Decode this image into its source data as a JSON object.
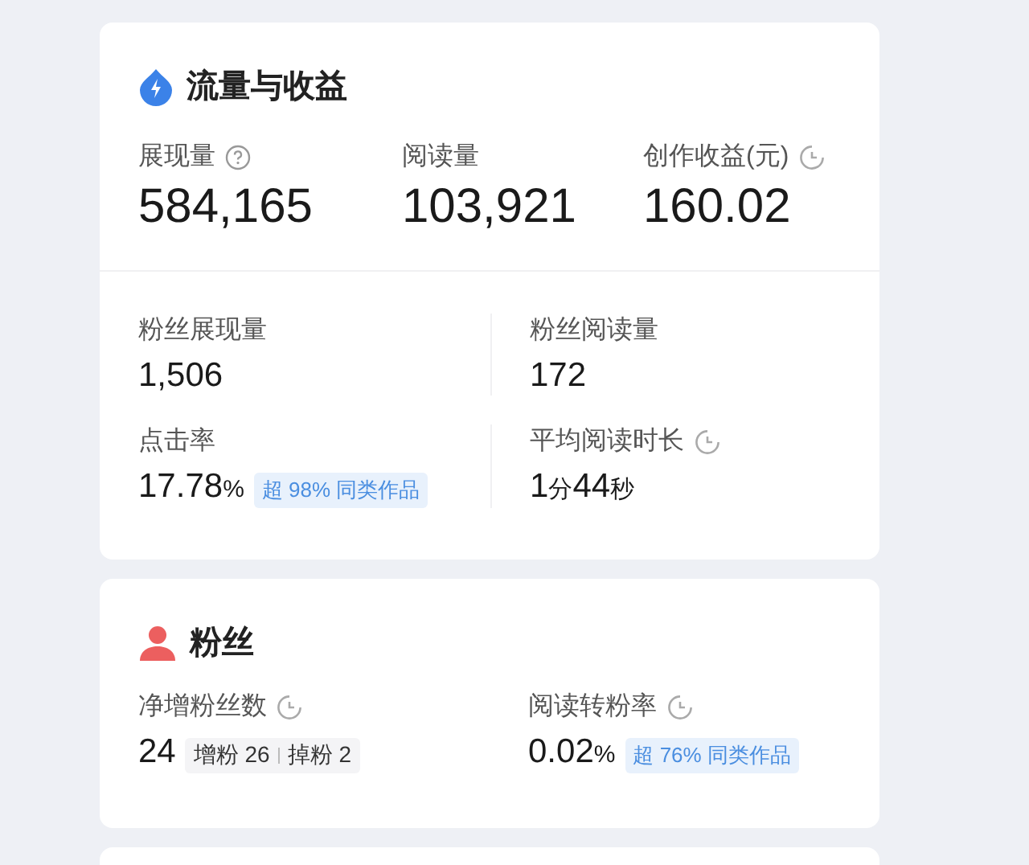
{
  "cards": [
    {
      "kind": "traffic",
      "title": "流量与收益",
      "metrics": [
        {
          "kind": "help",
          "label": "展现量",
          "value": "584,165"
        },
        {
          "kind": "plain",
          "label": "阅读量",
          "value": "103,921"
        },
        {
          "kind": "timed",
          "label": "创作收益(元)",
          "value": "160.02"
        }
      ],
      "details": [
        {
          "kind": "plain",
          "label": "粉丝展现量",
          "parts": [
            {
              "kind": "number",
              "text": "1,506"
            }
          ]
        },
        {
          "kind": "plain",
          "label": "粉丝阅读量",
          "parts": [
            {
              "kind": "number",
              "text": "172"
            }
          ]
        },
        {
          "kind": "plain",
          "label": "点击率",
          "parts": [
            {
              "kind": "number",
              "text": "17.78"
            },
            {
              "kind": "unit",
              "text": "%"
            }
          ],
          "badge": "超 98% 同类作品"
        },
        {
          "kind": "timed",
          "label": "平均阅读时长",
          "parts": [
            {
              "kind": "number",
              "text": "1"
            },
            {
              "kind": "unit",
              "text": "分"
            },
            {
              "kind": "number",
              "text": "44"
            },
            {
              "kind": "unit",
              "text": "秒"
            }
          ]
        }
      ]
    },
    {
      "kind": "fans",
      "title": "粉丝",
      "details": [
        {
          "kind": "timed",
          "label": "净增粉丝数",
          "parts": [
            {
              "kind": "number",
              "text": "24"
            }
          ],
          "breakdown": [
            "增粉 26",
            "掉粉 2"
          ]
        },
        {
          "kind": "timed",
          "label": "阅读转粉率",
          "parts": [
            {
              "kind": "number",
              "text": "0.02"
            },
            {
              "kind": "unit",
              "text": "%"
            }
          ],
          "badge": "超 76% 同类作品"
        }
      ]
    },
    {
      "kind": "placeholder"
    }
  ]
}
